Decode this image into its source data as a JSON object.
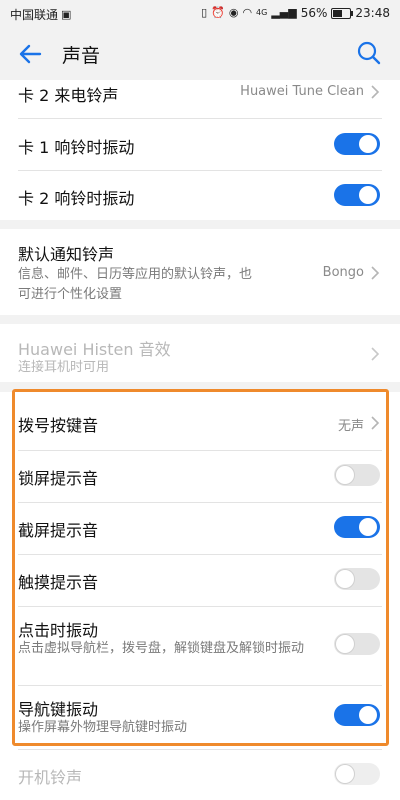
{
  "status_bar": {
    "carrier": "中国联通",
    "network": "4G",
    "battery": "56%",
    "battery_level": 0.56,
    "time": "23:48"
  },
  "header": {
    "title": "声音"
  },
  "items": {
    "card2_ringtone": {
      "title": "卡 2 来电铃声",
      "value": "Huawei Tune Clean"
    },
    "card1_vibrate": {
      "title": "卡 1 响铃时振动",
      "on": true
    },
    "card2_vibrate": {
      "title": "卡 2 响铃时振动",
      "on": true
    },
    "notify_ringtone": {
      "title": "默认通知铃声",
      "subtitle": "信息、邮件、日历等应用的默认铃声，也可进行个性化设置",
      "value": "Bongo"
    },
    "histen": {
      "title": "Huawei Histen 音效",
      "subtitle": "连接耳机时可用"
    },
    "dial_tone": {
      "title": "拨号按键音",
      "value": "无声"
    },
    "lock_tone": {
      "title": "锁屏提示音",
      "on": false
    },
    "screenshot_tone": {
      "title": "截屏提示音",
      "on": true
    },
    "touch_tone": {
      "title": "触摸提示音",
      "on": false
    },
    "tap_vibrate": {
      "title": "点击时振动",
      "subtitle": "点击虚拟导航栏，拨号盘，解锁键盘及解锁时振动",
      "on": false
    },
    "nav_vibrate": {
      "title": "导航键振动",
      "subtitle": "操作屏幕外物理导航键时振动",
      "on": true
    },
    "boot_ringtone": {
      "title": "开机铃声",
      "on": false
    }
  },
  "colors": {
    "accent": "#1a73e8",
    "highlight": "#ef8a2c"
  }
}
